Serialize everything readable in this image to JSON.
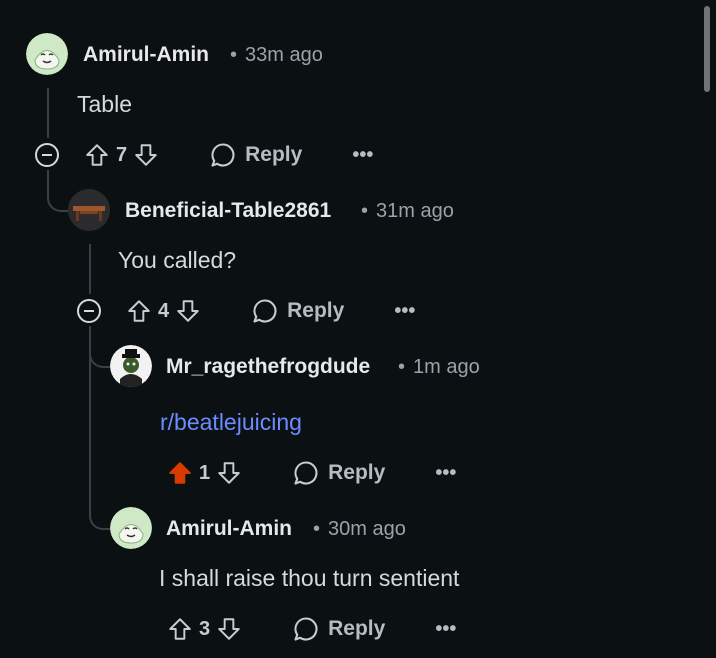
{
  "comments": [
    {
      "username": "Amirul-Amin",
      "time": "33m ago",
      "body": "Table",
      "votes": "7",
      "reply_label": "Reply",
      "more_label": "•••"
    },
    {
      "username": "Beneficial-Table2861",
      "time": "31m ago",
      "body": "You called?",
      "votes": "4",
      "reply_label": "Reply",
      "more_label": "•••"
    },
    {
      "username": "Mr_ragethefrogdude",
      "time": "1m ago",
      "body": "r/beatlejuicing",
      "votes": "1",
      "upvoted": true,
      "reply_label": "Reply",
      "more_label": "•••"
    },
    {
      "username": "Amirul-Amin",
      "time": "30m ago",
      "body": "I shall raise thou turn sentient",
      "votes": "3",
      "reply_label": "Reply",
      "more_label": "•••"
    }
  ],
  "dot": "•",
  "colors": {
    "background": "#0b1013",
    "upvote_active": "#d93a00",
    "link": "#6b8cff"
  }
}
